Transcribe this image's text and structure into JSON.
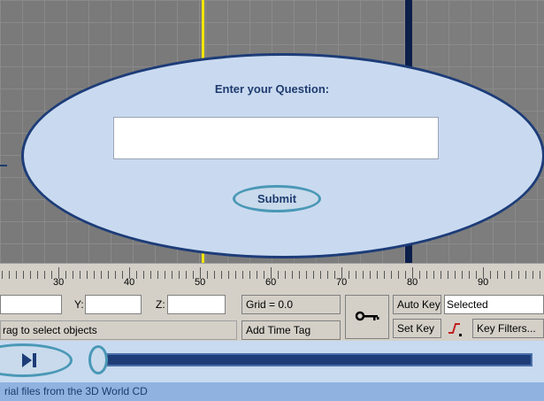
{
  "dialog": {
    "title": "Enter your Question:",
    "input_value": "",
    "submit_label": "Submit"
  },
  "ruler": {
    "labels": [
      "30",
      "40",
      "50",
      "60",
      "70",
      "80",
      "90"
    ]
  },
  "transform": {
    "y_label": "Y:",
    "z_label": "Z:",
    "x_value": "",
    "y_value": "",
    "z_value": ""
  },
  "status": {
    "prompt_text": "rag to select objects",
    "grid_text": "Grid = 0.0",
    "add_time_tag": "Add Time Tag"
  },
  "animation": {
    "auto_key": "Auto Key",
    "set_key": "Set Key",
    "selected_dropdown": "Selected",
    "key_filters": "Key Filters..."
  },
  "footer": {
    "text": "rial files from the 3D World CD"
  },
  "colors": {
    "dialog_fill": "#c9daf0",
    "dialog_border": "#1d3c78",
    "viewport_active_border": "#f2e600"
  }
}
